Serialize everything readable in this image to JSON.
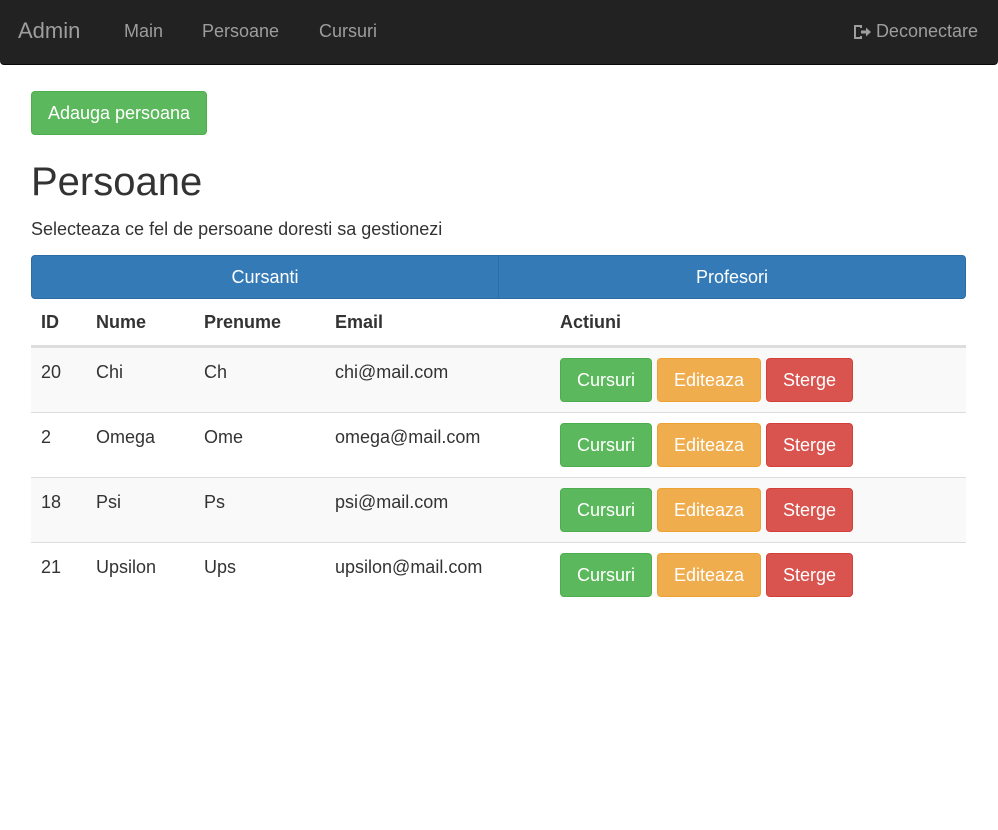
{
  "navbar": {
    "brand": "Admin",
    "links": [
      "Main",
      "Persoane",
      "Cursuri"
    ],
    "logout_label": "Deconectare",
    "logout_icon": "logout-icon"
  },
  "toolbar": {
    "add_label": "Adauga persoana"
  },
  "page": {
    "title": "Persoane",
    "subtitle": "Selecteaza ce fel de persoane doresti sa gestionezi"
  },
  "segments": [
    "Cursanti",
    "Profesori"
  ],
  "table": {
    "headers": [
      "ID",
      "Nume",
      "Prenume",
      "Email",
      "Actiuni"
    ],
    "actions": {
      "cursuri": "Cursuri",
      "edit": "Editeaza",
      "delete": "Sterge"
    },
    "rows": [
      {
        "id": "20",
        "nume": "Chi",
        "prenume": "Ch",
        "email": "chi@mail.com"
      },
      {
        "id": "2",
        "nume": "Omega",
        "prenume": "Ome",
        "email": "omega@mail.com"
      },
      {
        "id": "18",
        "nume": "Psi",
        "prenume": "Ps",
        "email": "psi@mail.com"
      },
      {
        "id": "21",
        "nume": "Upsilon",
        "prenume": "Ups",
        "email": "upsilon@mail.com"
      }
    ]
  },
  "colors": {
    "navbar": "#222222",
    "primary": "#337ab7",
    "success": "#5cb85c",
    "warning": "#f0ad4e",
    "danger": "#d9534f"
  }
}
